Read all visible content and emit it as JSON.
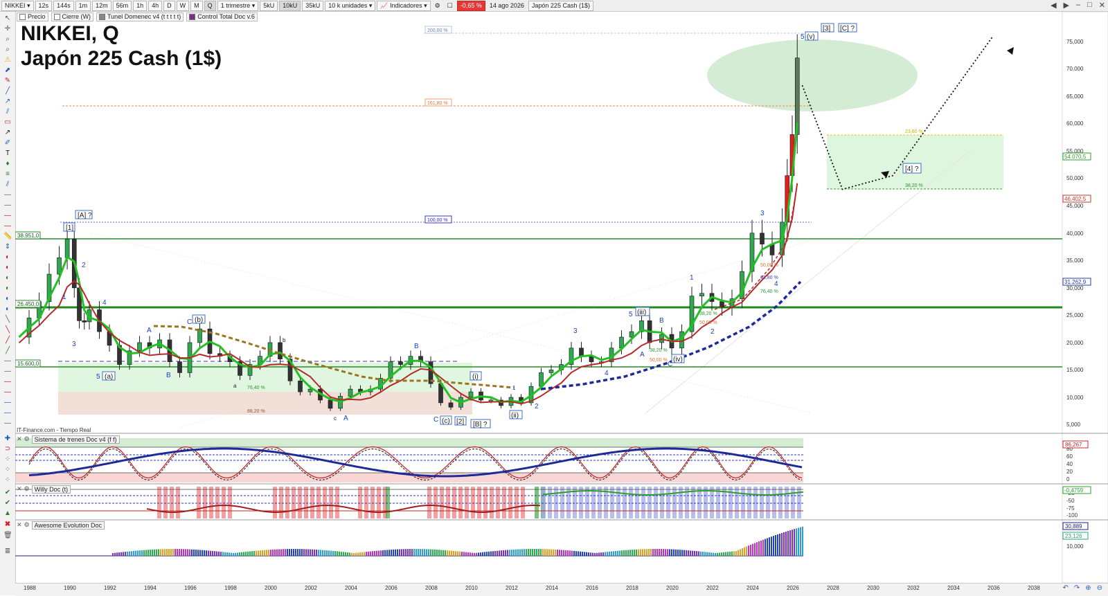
{
  "toolbar": {
    "symbol": "NIKKEI",
    "timeframes": [
      "12s",
      "144s",
      "1m",
      "12m",
      "56m",
      "1h",
      "4h",
      "D",
      "W",
      "M",
      "Q"
    ],
    "period": "1 trimestre",
    "units": [
      "5kU",
      "10kU",
      "35kU"
    ],
    "unit_select": "10 k unidades",
    "indicators_label": "Indicadores",
    "change": "-0,65 %",
    "date": "14 ago 2026",
    "instrument": "Japón 225 Cash (1$)"
  },
  "indicator_tags": [
    "Precio",
    "Cierre (W)",
    "Tunel Domenec v4 (t t t t t)",
    "Control Total Doc v.6"
  ],
  "title": {
    "line1": "NIKKEI, Q",
    "line2": "Japón 225 Cash (1$)"
  },
  "source_label": "IT-Finance.com - Tiempo Real",
  "subpanels": [
    {
      "name": "Sistema de trenes Doc v4 (f f)",
      "ticks": [
        "80",
        "60",
        "40",
        "20",
        "0"
      ],
      "value": "86,267"
    },
    {
      "name": "Willy Doc (t)",
      "ticks": [
        "-25",
        "-50",
        "-75",
        "-100"
      ],
      "value": "-0,4759"
    },
    {
      "name": "Awesome Evolution Doc",
      "ticks": [
        "10,000"
      ],
      "values": [
        "30,889",
        "23,126"
      ]
    }
  ],
  "price_axis": {
    "ticks": [
      "75,000",
      "70,000",
      "65,000",
      "60,000",
      "55,000",
      "50,000",
      "45,000",
      "40,000",
      "35,000",
      "30,000",
      "25,000",
      "20,000",
      "15,000",
      "10,000",
      "5,000"
    ],
    "tags": [
      {
        "text": "54.070,5",
        "color": "#2e9d2e"
      },
      {
        "text": "46.402,5",
        "color": "#c0392b"
      },
      {
        "text": "31.262,9",
        "color": "#2a3ca0"
      }
    ]
  },
  "level_tags": [
    "38.951,0",
    "26.450,0",
    "15.600,0"
  ],
  "fib_labels": [
    "200,00 %",
    "161,80 %",
    "100,00 %",
    "23,60 %",
    "38,20 %",
    "76,40 %",
    "88,20 %",
    "38,20 %",
    "50,00 %",
    "61,80 %",
    "76,40 %",
    "50,00 %",
    "38,20 %",
    "50,00 %"
  ],
  "wave_labels": {
    "boxed": [
      "[1]",
      "[A] ?",
      "(a)",
      "(b)",
      "(c)",
      "[2]",
      "[B] ?",
      "(i)",
      "(ii)",
      "(iii)",
      "(iv)",
      "(v)",
      "[3]",
      "[C] ?",
      "[4] ?"
    ],
    "plain": [
      "1",
      "2",
      "3",
      "4",
      "5",
      "C",
      "B",
      "A",
      "a",
      "b",
      "c",
      "A",
      "B",
      "C",
      "1",
      "2",
      "3",
      "4",
      "5",
      "A",
      "B",
      "C",
      "1",
      "2",
      "3",
      "4",
      "5"
    ]
  },
  "years": [
    "1988",
    "1990",
    "1992",
    "1994",
    "1996",
    "1998",
    "2000",
    "2002",
    "2004",
    "2006",
    "2008",
    "2010",
    "2012",
    "2014",
    "2016",
    "2018",
    "2020",
    "2022",
    "2024",
    "2026",
    "2028",
    "2030",
    "2032",
    "2034",
    "2036",
    "2038"
  ],
  "chart_data": {
    "type": "candlestick",
    "interval": "quarterly",
    "x_range": [
      "1987",
      "2039"
    ],
    "ylim": [
      4000,
      78000
    ],
    "close_series": [
      [
        1987.5,
        21000
      ],
      [
        1988.0,
        24500
      ],
      [
        1988.5,
        27500
      ],
      [
        1989.0,
        32500
      ],
      [
        1989.5,
        35500
      ],
      [
        1989.9,
        38900
      ],
      [
        1990.25,
        30000
      ],
      [
        1990.5,
        24000
      ],
      [
        1990.75,
        23800
      ],
      [
        1991.0,
        26000
      ],
      [
        1991.5,
        22000
      ],
      [
        1992.0,
        19500
      ],
      [
        1992.5,
        16000
      ],
      [
        1993.0,
        18500
      ],
      [
        1993.5,
        20000
      ],
      [
        1994.0,
        19000
      ],
      [
        1994.5,
        20500
      ],
      [
        1995.0,
        16500
      ],
      [
        1995.5,
        14500
      ],
      [
        1996.0,
        20000
      ],
      [
        1996.5,
        22500
      ],
      [
        1997.0,
        18000
      ],
      [
        1997.5,
        17500
      ],
      [
        1998.0,
        16500
      ],
      [
        1998.5,
        14000
      ],
      [
        1999.0,
        16000
      ],
      [
        1999.5,
        17500
      ],
      [
        2000.0,
        20000
      ],
      [
        2000.5,
        17000
      ],
      [
        2001.0,
        13000
      ],
      [
        2001.5,
        11000
      ],
      [
        2002.0,
        11500
      ],
      [
        2002.5,
        9500
      ],
      [
        2003.0,
        8000
      ],
      [
        2003.5,
        10200
      ],
      [
        2004.0,
        11500
      ],
      [
        2004.5,
        11000
      ],
      [
        2005.0,
        11500
      ],
      [
        2005.5,
        13500
      ],
      [
        2006.0,
        16500
      ],
      [
        2006.5,
        16000
      ],
      [
        2007.0,
        17500
      ],
      [
        2007.5,
        16500
      ],
      [
        2008.0,
        12500
      ],
      [
        2008.5,
        9000
      ],
      [
        2009.0,
        8200
      ],
      [
        2009.5,
        10000
      ],
      [
        2010.0,
        11000
      ],
      [
        2010.5,
        9500
      ],
      [
        2011.0,
        9500
      ],
      [
        2011.5,
        8500
      ],
      [
        2012.0,
        10000
      ],
      [
        2012.5,
        9000
      ],
      [
        2013.0,
        12000
      ],
      [
        2013.5,
        14500
      ],
      [
        2014.0,
        15000
      ],
      [
        2014.5,
        16000
      ],
      [
        2015.0,
        19000
      ],
      [
        2015.5,
        17500
      ],
      [
        2016.0,
        16500
      ],
      [
        2016.5,
        16500
      ],
      [
        2017.0,
        19000
      ],
      [
        2017.5,
        21000
      ],
      [
        2018.0,
        22000
      ],
      [
        2018.5,
        24000
      ],
      [
        2018.9,
        20000
      ],
      [
        2019.5,
        21500
      ],
      [
        2020.0,
        19000
      ],
      [
        2020.5,
        22000
      ],
      [
        2021.0,
        28500
      ],
      [
        2021.5,
        29000
      ],
      [
        2022.0,
        27500
      ],
      [
        2022.5,
        26500
      ],
      [
        2023.0,
        28000
      ],
      [
        2023.5,
        33000
      ],
      [
        2024.0,
        40000
      ],
      [
        2024.5,
        38000
      ],
      [
        2025.0,
        36000
      ],
      [
        2025.5,
        42000
      ],
      [
        2025.75,
        50500
      ],
      [
        2026.0,
        58000
      ],
      [
        2026.25,
        72000
      ]
    ],
    "horizontal_levels": [
      38951,
      26450,
      15600
    ],
    "projection": [
      [
        2026.5,
        67000
      ],
      [
        2028.5,
        48000
      ],
      [
        2031.0,
        50500
      ],
      [
        2036.0,
        76000
      ]
    ],
    "target_zone": {
      "y": [
        48000,
        58000
      ],
      "labels": [
        "23,60 %",
        "38,20 %"
      ]
    }
  }
}
